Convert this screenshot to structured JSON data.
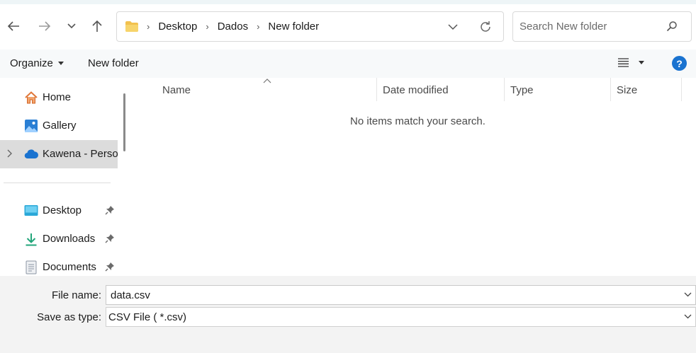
{
  "address": {
    "crumbs": [
      "Desktop",
      "Dados",
      "New folder"
    ]
  },
  "search": {
    "placeholder": "Search New folder"
  },
  "toolbar": {
    "organize_label": "Organize",
    "new_folder_label": "New folder",
    "help_label": "?"
  },
  "nav": {
    "items": [
      {
        "label": "Home",
        "icon": "home-icon"
      },
      {
        "label": "Gallery",
        "icon": "gallery-icon"
      },
      {
        "label": "Kawena - Personal",
        "icon": "onedrive-cloud-icon",
        "selected": true
      },
      {
        "label": "Desktop",
        "icon": "desktop-icon",
        "pinned": true
      },
      {
        "label": "Downloads",
        "icon": "downloads-icon",
        "pinned": true
      },
      {
        "label": "Documents",
        "icon": "documents-icon",
        "pinned": true
      }
    ]
  },
  "columns": [
    "Name",
    "Date modified",
    "Type",
    "Size"
  ],
  "empty_message": "No items match your search.",
  "form": {
    "file_name_label": "File name:",
    "file_name_value": "data.csv",
    "save_type_label": "Save as type:",
    "save_type_value": "CSV File  ( *.csv)"
  },
  "colors": {
    "accent": "#1a73d0",
    "folder": "#f2c14e",
    "selected_bg": "#dcdcdc"
  }
}
